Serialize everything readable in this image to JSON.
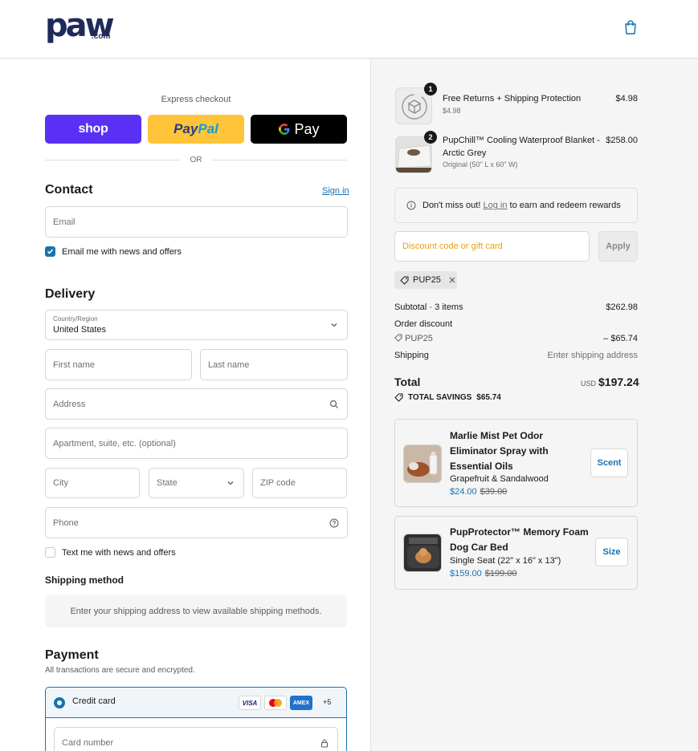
{
  "brand": {
    "logo_text": "paw",
    "logo_suffix": ".com"
  },
  "express": {
    "label": "Express checkout",
    "shop_label": "shop",
    "paypal_part1": "Pay",
    "paypal_part2": "Pal",
    "gpay_label": "Pay",
    "or_label": "OR"
  },
  "contact": {
    "title": "Contact",
    "sign_in": "Sign in",
    "email_placeholder": "Email",
    "newsletter_label": "Email me with news and offers",
    "newsletter_checked": true
  },
  "delivery": {
    "title": "Delivery",
    "country_label": "Country/Region",
    "country_value": "United States",
    "first_name": "First name",
    "last_name": "Last name",
    "address": "Address",
    "apartment": "Apartment, suite, etc. (optional)",
    "city": "City",
    "state": "State",
    "zip": "ZIP code",
    "phone": "Phone",
    "text_label": "Text me with news and offers",
    "text_checked": false
  },
  "shipping_method": {
    "title": "Shipping method",
    "message": "Enter your shipping address to view available shipping methods."
  },
  "payment": {
    "title": "Payment",
    "subtitle": "All transactions are secure and encrypted.",
    "credit_card_label": "Credit card",
    "card_logos": [
      "VISA",
      "MC",
      "AMEX"
    ],
    "more_cards": "+5",
    "card_number_placeholder": "Card number"
  },
  "order": {
    "items": [
      {
        "qty": "1",
        "title": "Free Returns + Shipping Protection",
        "sub": "$4.98",
        "price": "$4.98"
      },
      {
        "qty": "2",
        "title_line1": "PupChill™ Cooling Waterproof Blanket -",
        "title_line2": "Arctic Grey",
        "sub": "Original (50\" L x 60\" W)",
        "price": "$258.00"
      }
    ],
    "rewards_text_1": "Don't miss out!",
    "rewards_link": "Log in",
    "rewards_text_2": "to earn and redeem rewards",
    "discount_placeholder": "Discount code or gift card",
    "apply_label": "Apply",
    "applied_code": "PUP25"
  },
  "summary": {
    "subtotal_label": "Subtotal · 3 items",
    "subtotal_value": "$262.98",
    "order_discount_label": "Order discount",
    "discount_code": "PUP25",
    "discount_value": "– $65.74",
    "shipping_label": "Shipping",
    "shipping_value": "Enter shipping address",
    "total_label": "Total",
    "currency": "USD",
    "total_value": "$197.24",
    "savings_label": "TOTAL SAVINGS",
    "savings_value": "$65.74"
  },
  "upsells": [
    {
      "title_line1": "Marlie Mist Pet Odor",
      "title_line2": "Eliminator Spray with",
      "title_line3": "Essential Oils",
      "variant": "Grapefruit & Sandalwood",
      "price": "$24.00",
      "compare_price": "$39.00",
      "button": "Scent"
    },
    {
      "title_line1": "PupProtector™ Memory Foam",
      "title_line2": "Dog Car Bed",
      "variant": "Single Seat (22\" x 16\" x 13\")",
      "price": "$159.00",
      "compare_price": "$199.00",
      "button": "Size"
    }
  ]
}
